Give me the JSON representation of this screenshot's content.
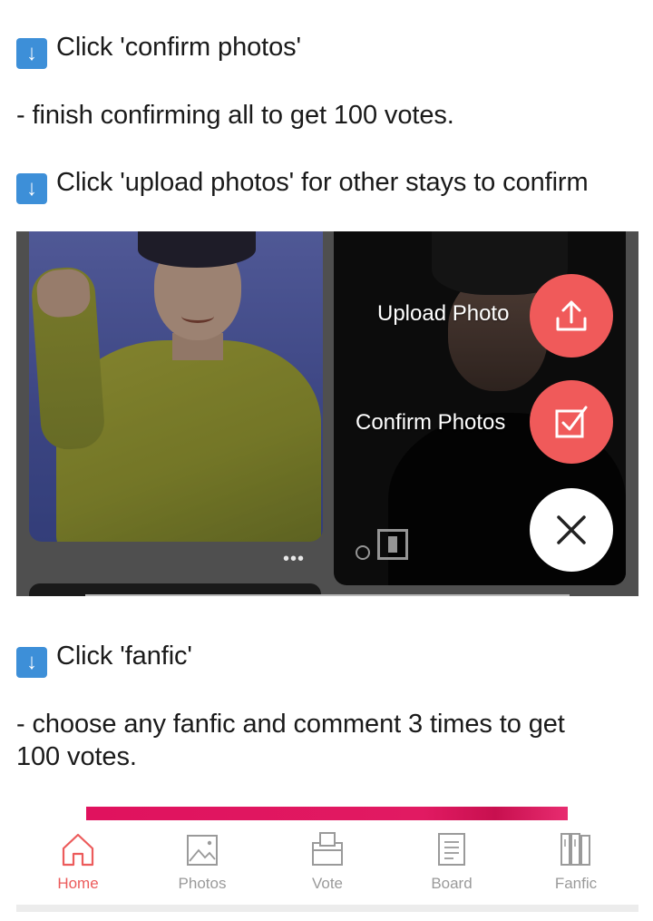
{
  "instructions": {
    "line1": "Click 'confirm photos'",
    "line2": "- finish confirming all to get 100 votes.",
    "line3": "Click 'upload photos' for other stays to confirm",
    "line4": "Click 'fanfic'",
    "line5": "- choose any fanfic and comment 3 times to get 100 votes."
  },
  "arrow_icon": "down-arrow-icon",
  "fab_menu": {
    "upload_label": "Upload Photo",
    "confirm_label": "Confirm Photos",
    "upload_icon": "upload-icon",
    "confirm_icon": "checkbox-icon",
    "close_icon": "close-icon",
    "accent": "#f05a5a"
  },
  "card_more": "•••",
  "nav": {
    "items": [
      {
        "label": "Home",
        "icon": "home-icon",
        "active": true
      },
      {
        "label": "Photos",
        "icon": "image-icon"
      },
      {
        "label": "Vote",
        "icon": "ballot-box-icon"
      },
      {
        "label": "Board",
        "icon": "document-icon"
      },
      {
        "label": "Fanfic",
        "icon": "books-icon"
      }
    ],
    "active_color": "#ec5b5b",
    "inactive_color": "#9a9a9a"
  }
}
